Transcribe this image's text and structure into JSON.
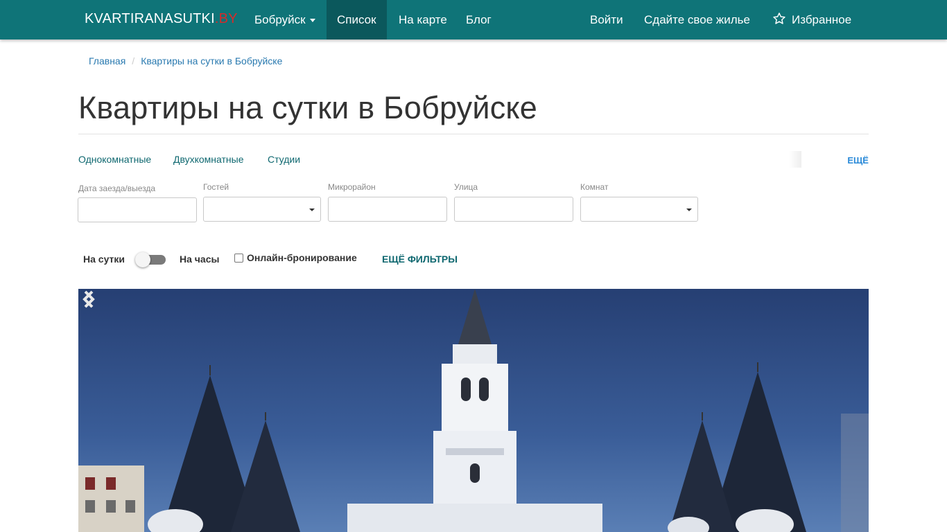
{
  "navbar": {
    "brand_main": "KVARTIRANASUTKI",
    "brand_tld": ".BY",
    "city": "Бобруйск",
    "list": "Список",
    "map": "На карте",
    "blog": "Блог",
    "login": "Войти",
    "rent_out": "Сдайте свое жилье",
    "favorites": "Избранное",
    "colors": {
      "bar": "#0f7478",
      "active": "#0b585c",
      "tld": "#d62b2b"
    }
  },
  "breadcrumb": {
    "home": "Главная",
    "current": "Квартиры на сутки в Бобруйске"
  },
  "page": {
    "title": "Квартиры на сутки в Бобруйске"
  },
  "types": {
    "one_room": "Однокомнатные",
    "two_room": "Двухкомнатные",
    "studio": "Студии",
    "more": "ЕЩЁ"
  },
  "filters": {
    "dates": {
      "label": "Дата заезда/выезда",
      "value": ""
    },
    "guests": {
      "label": "Гостей",
      "value": ""
    },
    "district": {
      "label": "Микрорайон",
      "value": ""
    },
    "street": {
      "label": "Улица",
      "value": ""
    },
    "rooms": {
      "label": "Комнат",
      "value": ""
    }
  },
  "mode": {
    "daily": "На сутки",
    "hourly": "На часы",
    "hourly_enabled": false,
    "online_booking": "Онлайн-бронирование",
    "online_booking_checked": false,
    "more_filters": "ЕЩЁ ФИЛЬТРЫ"
  },
  "carousel": {
    "prev_icon": "chevron-left-icon",
    "next_icon": "chevron-right-icon"
  }
}
